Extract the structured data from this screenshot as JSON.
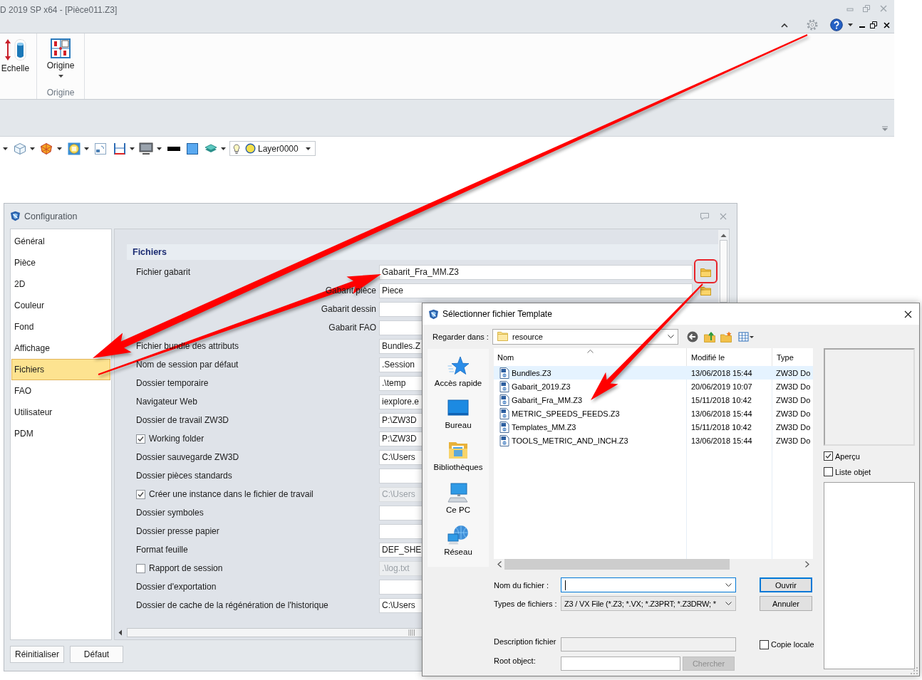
{
  "app_window": {
    "title": "D 2019 SP x64 - [Pièce011.Z3]",
    "ribbon": {
      "groups": [
        {
          "buttons": [
            {
              "kind": "scale",
              "label": "Echelle"
            }
          ]
        },
        {
          "label": "Origine",
          "buttons": [
            {
              "kind": "origin",
              "label": "Origine"
            }
          ]
        }
      ]
    },
    "toolbar": {
      "layer": "Layer0000"
    }
  },
  "configuration": {
    "title": "Configuration",
    "categories": [
      {
        "label": "Général",
        "selected": false
      },
      {
        "label": "Pièce",
        "selected": false
      },
      {
        "label": "2D",
        "selected": false
      },
      {
        "label": "Couleur",
        "selected": false
      },
      {
        "label": "Fond",
        "selected": false
      },
      {
        "label": "Affichage",
        "selected": false
      },
      {
        "label": "Fichiers",
        "selected": true
      },
      {
        "label": "FAO",
        "selected": false
      },
      {
        "label": "Utilisateur",
        "selected": false
      },
      {
        "label": "PDM",
        "selected": false
      }
    ],
    "section_title": "Fichiers",
    "fields": [
      {
        "kind": "field",
        "label": "Fichier gabarit",
        "value": "Gabarit_Fra_MM.Z3",
        "disabled": false,
        "browse": true
      },
      {
        "kind": "subfield",
        "label": "Gabarit pièce",
        "value": "Piece",
        "disabled": false,
        "browse": true
      },
      {
        "kind": "subfield",
        "label": "Gabarit dessin",
        "disabled": false
      },
      {
        "kind": "subfield",
        "label": "Gabarit FAO",
        "disabled": false
      },
      {
        "kind": "field",
        "label": "Fichier bundle des attributs",
        "value": "Bundles.Z",
        "disabled": false
      },
      {
        "kind": "field",
        "label": "Nom de session par défaut",
        "value": ".Session",
        "disabled": false
      },
      {
        "kind": "field",
        "label": "Dossier temporaire",
        "value": ".\\temp",
        "disabled": false
      },
      {
        "kind": "field",
        "label": "Navigateur Web",
        "value": "iexplore.e",
        "disabled": false
      },
      {
        "kind": "field",
        "label": "Dossier de travail ZW3D",
        "value": "P:\\ZW3D",
        "disabled": false
      },
      {
        "kind": "check",
        "label": "Working folder",
        "checked": true,
        "value": "P:\\ZW3D",
        "disabled": false
      },
      {
        "kind": "field",
        "label": "Dossier sauvegarde ZW3D",
        "value": "C:\\Users",
        "disabled": false
      },
      {
        "kind": "field",
        "label": "Dossier pièces standards",
        "disabled": false
      },
      {
        "kind": "check",
        "label": "Créer une instance dans le fichier de travail",
        "checked": true,
        "value": "C:\\Users",
        "disabled": true
      },
      {
        "kind": "field",
        "label": "Dossier symboles",
        "disabled": false
      },
      {
        "kind": "field",
        "label": "Dossier presse papier",
        "disabled": false
      },
      {
        "kind": "field",
        "label": "Format feuille",
        "value": "DEF_SHE",
        "disabled": false
      },
      {
        "kind": "check",
        "label": "Rapport de session",
        "checked": false,
        "value": ".\\log.txt",
        "disabled": true
      },
      {
        "kind": "field",
        "label": "Dossier d'exportation",
        "disabled": false
      },
      {
        "kind": "field",
        "label": "Dossier de cache de la régénération de l'historique",
        "value": "C:\\Users",
        "disabled": false
      }
    ],
    "buttons": [
      "Réinitialiser",
      "Défaut"
    ]
  },
  "file_dialog": {
    "title": "Sélectionner fichier Template",
    "look_in": {
      "label": "Regarder dans :",
      "value": "resource"
    },
    "places": [
      {
        "kind": "star",
        "label": "Accès rapide"
      },
      {
        "kind": "desktop",
        "label": "Bureau"
      },
      {
        "kind": "library",
        "label": "Bibliothèques"
      },
      {
        "kind": "computer",
        "label": "Ce PC"
      },
      {
        "kind": "network",
        "label": "Réseau"
      }
    ],
    "columns": [
      "Nom",
      "Modifié le",
      "Type"
    ],
    "files": [
      {
        "name": "Bundles.Z3",
        "modified": "13/06/2018 15:44",
        "type": "ZW3D Do",
        "selected": true
      },
      {
        "name": "Gabarit_2019.Z3",
        "modified": "20/06/2019 10:07",
        "type": "ZW3D Do",
        "selected": false
      },
      {
        "name": "Gabarit_Fra_MM.Z3",
        "modified": "15/11/2018 10:42",
        "type": "ZW3D Do",
        "selected": false
      },
      {
        "name": "METRIC_SPEEDS_FEEDS.Z3",
        "modified": "13/06/2018 15:44",
        "type": "ZW3D Do",
        "selected": false
      },
      {
        "name": "Templates_MM.Z3",
        "modified": "15/11/2018 10:42",
        "type": "ZW3D Do",
        "selected": false
      },
      {
        "name": "TOOLS_METRIC_AND_INCH.Z3",
        "modified": "13/06/2018 15:44",
        "type": "ZW3D Do",
        "selected": false
      }
    ],
    "preview_options": [
      {
        "label": "Aperçu",
        "checked": true
      },
      {
        "label": "Liste objet",
        "checked": false
      }
    ],
    "file_name": {
      "label": "Nom du fichier :",
      "focused": true
    },
    "file_types": {
      "label": "Types de fichiers :",
      "value": "Z3 / VX File (*.Z3; *.VX; *.Z3PRT; *.Z3DRW; *"
    },
    "buttons": [
      {
        "label": "Ouvrir",
        "focused": true
      },
      {
        "label": "Annuler",
        "focused": false
      }
    ],
    "description": {
      "label": "Description fichier",
      "disabled": true
    },
    "local_copy": {
      "label": "Copie locale",
      "checked": false
    },
    "root_object": {
      "label": "Root object:"
    },
    "search_button": {
      "label": "Chercher",
      "disabled": true
    }
  }
}
